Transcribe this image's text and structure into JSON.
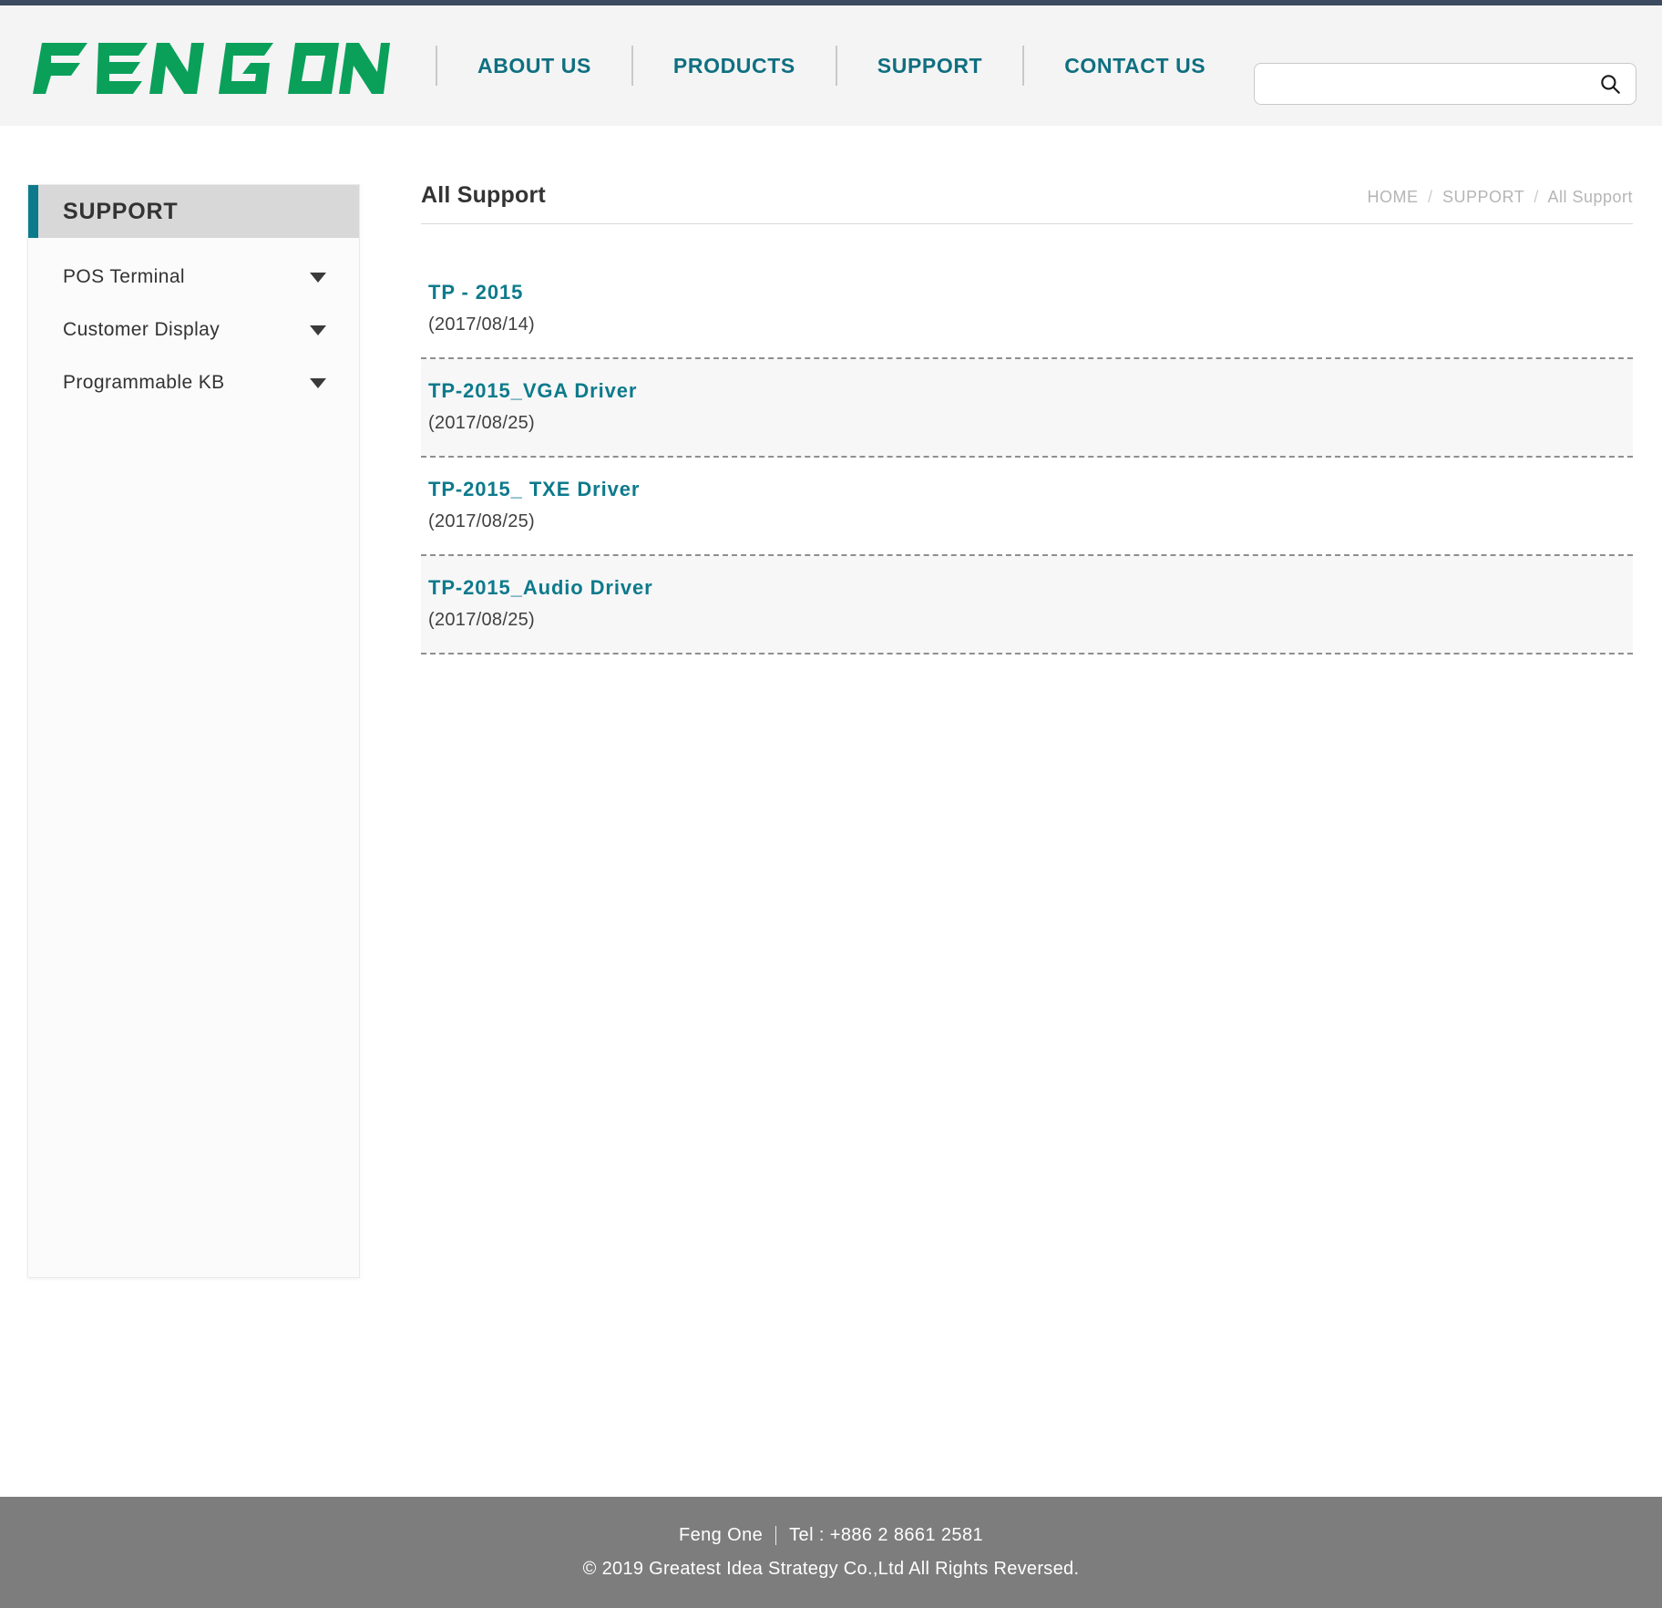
{
  "brand": {
    "logo_text": "FENG ONE",
    "logo_color": "#0aa05a",
    "accent_color": "#0d7a8c",
    "topbar_color": "#3b4a5e"
  },
  "header": {
    "nav": [
      {
        "label": "ABOUT US"
      },
      {
        "label": "PRODUCTS"
      },
      {
        "label": "SUPPORT"
      },
      {
        "label": "CONTACT US"
      }
    ],
    "search": {
      "value": "",
      "placeholder": "",
      "icon": "search-icon"
    }
  },
  "sidebar": {
    "title": "SUPPORT",
    "items": [
      {
        "label": "POS Terminal",
        "icon": "chevron-down-icon"
      },
      {
        "label": "Customer Display",
        "icon": "chevron-down-icon"
      },
      {
        "label": "Programmable KB",
        "icon": "chevron-down-icon"
      }
    ]
  },
  "main": {
    "page_title": "All Support",
    "breadcrumb": {
      "items": [
        "HOME",
        "SUPPORT",
        "All Support"
      ],
      "separator": "/"
    },
    "list": [
      {
        "title": "TP - 2015",
        "date": "(2017/08/14)"
      },
      {
        "title": "TP-2015_VGA Driver",
        "date": "(2017/08/25)"
      },
      {
        "title": "TP-2015_ TXE Driver",
        "date": "(2017/08/25)"
      },
      {
        "title": "TP-2015_Audio Driver",
        "date": "(2017/08/25)"
      }
    ]
  },
  "footer": {
    "company": "Feng One",
    "tel": "Tel :  +886 2 8661 2581",
    "copyright": "© 2019 Greatest Idea Strategy Co.,Ltd All Rights Reversed."
  }
}
